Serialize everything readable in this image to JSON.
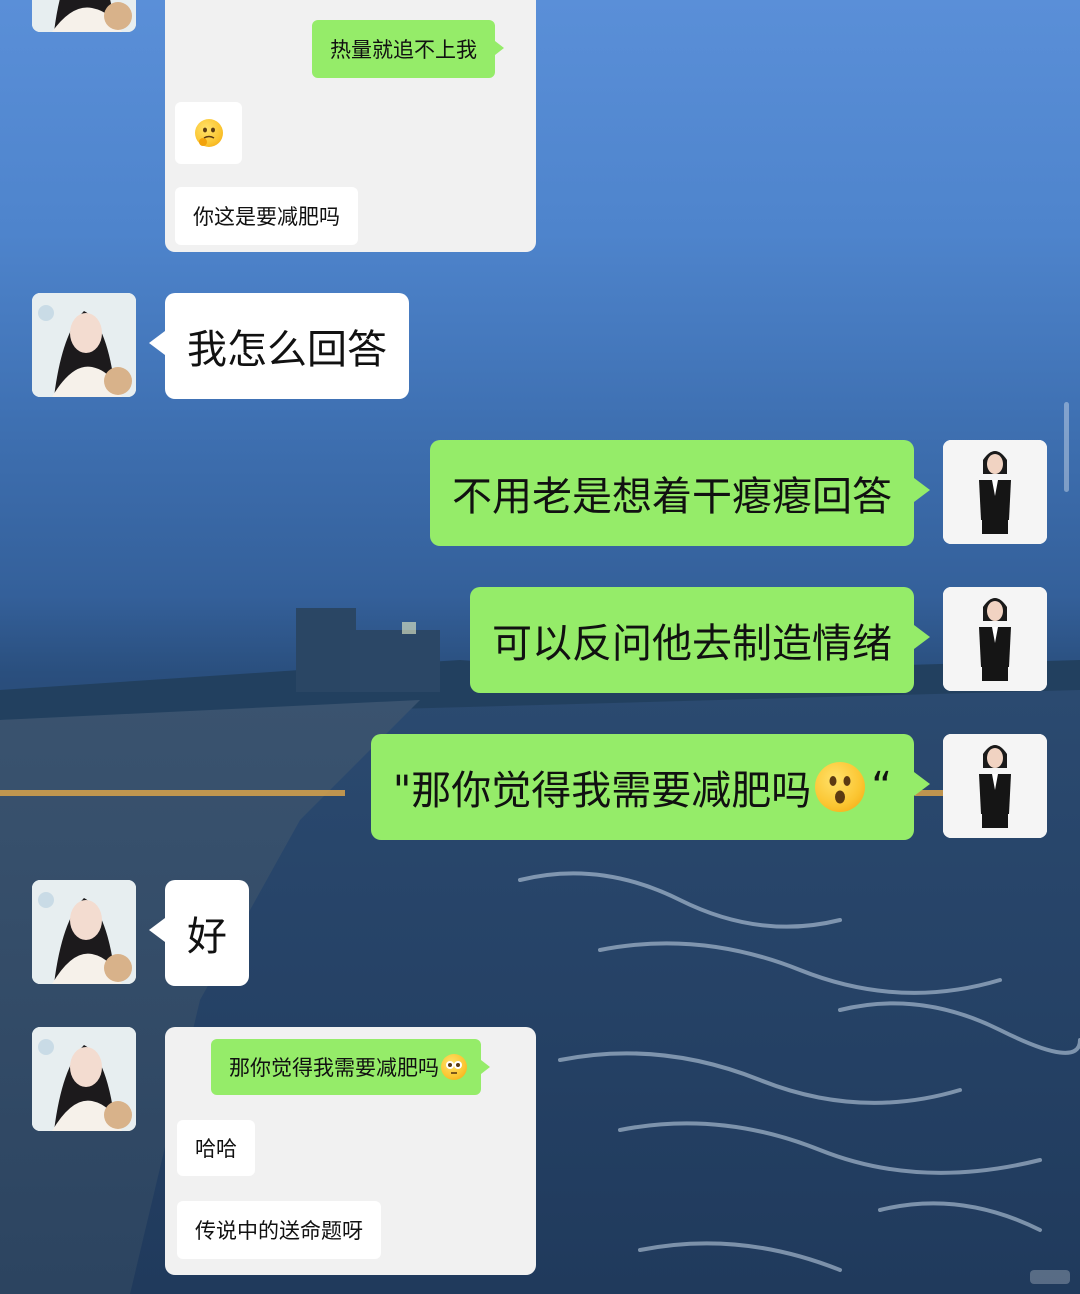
{
  "messages": {
    "top_card": {
      "green_1": "热量就追不上我",
      "white_2": "你这是要减肥吗"
    },
    "incoming_1": "我怎么回答",
    "outgoing_1": "不用老是想着干瘪瘪回答",
    "outgoing_2": "可以反问他去制造情绪",
    "outgoing_3": "\"那你觉得我需要减肥吗",
    "outgoing_3_end": "“",
    "incoming_2": "好",
    "bottom_card": {
      "green_1": "那你觉得我需要减肥吗",
      "white_2": "哈哈",
      "white_3": "传说中的送命题呀"
    }
  },
  "icons": {
    "thinking_emoji": "thinking-face",
    "surprised_emoji": "hushed-face",
    "flushed_emoji": "flushed-face"
  },
  "colors": {
    "outgoing_bubble": "#95ec69",
    "incoming_bubble": "#ffffff",
    "card_bg": "#f1f1f1"
  }
}
